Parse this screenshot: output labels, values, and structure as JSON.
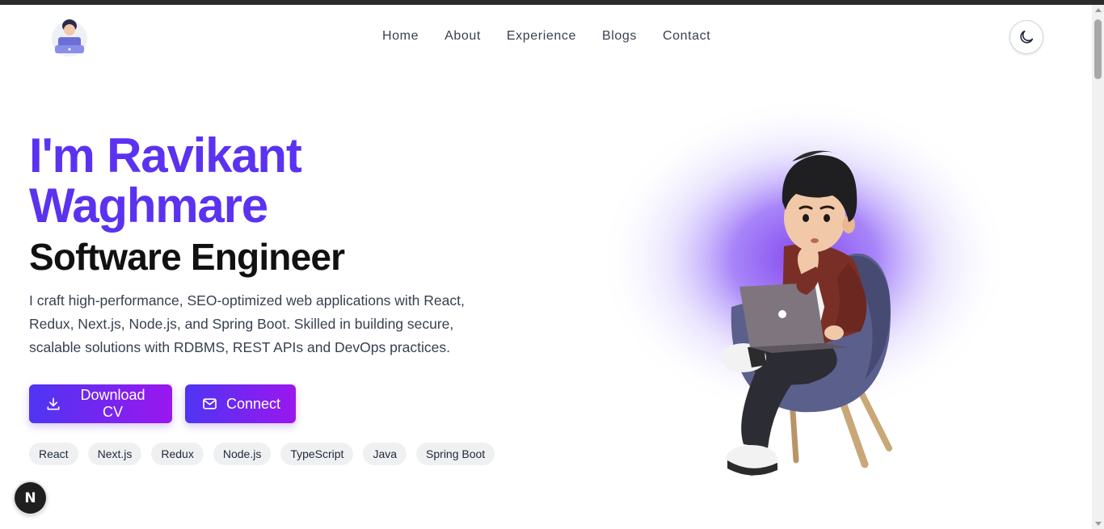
{
  "nav": {
    "items": [
      {
        "label": "Home"
      },
      {
        "label": "About"
      },
      {
        "label": "Experience"
      },
      {
        "label": "Blogs"
      },
      {
        "label": "Contact"
      }
    ]
  },
  "hero": {
    "name": "I'm Ravikant Waghmare",
    "role": "Software Engineer",
    "description": "I craft high-performance, SEO-optimized web applications with React, Redux, Next.js, Node.js, and Spring Boot. Skilled in building secure, scalable solutions with RDBMS, REST APIs and DevOps practices."
  },
  "buttons": {
    "download_cv": "Download CV",
    "connect": "Connect"
  },
  "skills": [
    "React",
    "Next.js",
    "Redux",
    "Node.js",
    "TypeScript",
    "Java",
    "Spring Boot"
  ],
  "next_badge": "N",
  "icons": {
    "theme_toggle": "moon-icon",
    "download": "download-icon",
    "connect": "mail-icon"
  },
  "colors": {
    "accent": "#5b32f0",
    "gradient_start": "#4f35f2",
    "gradient_end": "#9a17ee",
    "chip_bg": "#eff0f2"
  }
}
